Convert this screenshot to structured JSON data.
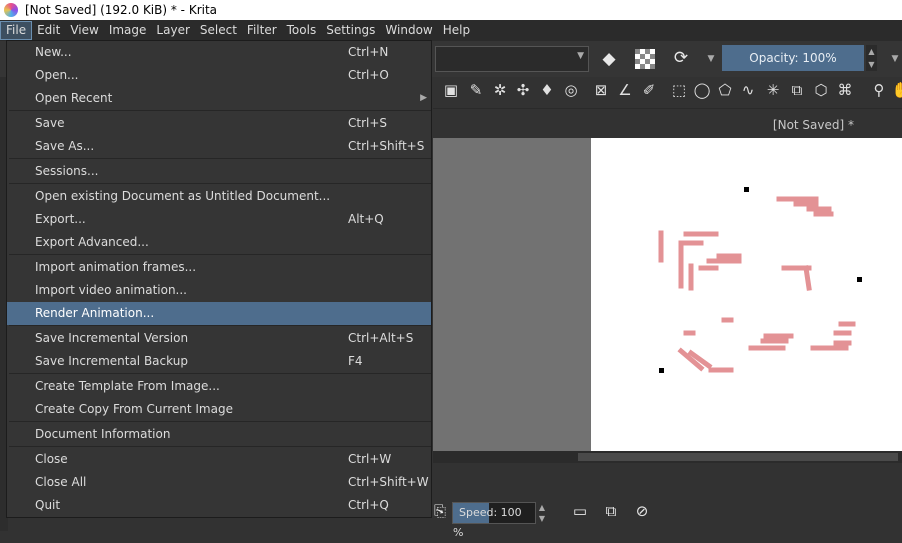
{
  "window": {
    "title": "[Not Saved]  (192.0 KiB)  * - Krita"
  },
  "menubar": {
    "items": [
      "File",
      "Edit",
      "View",
      "Image",
      "Layer",
      "Select",
      "Filter",
      "Tools",
      "Settings",
      "Window",
      "Help"
    ],
    "active": "File"
  },
  "toolbar": {
    "opacity_label": "Opacity: 100%"
  },
  "document": {
    "tab_label": "[Not Saved]  *"
  },
  "timeline": {
    "speed_label": "Speed: 100 %",
    "speed_fraction": 0.44
  },
  "file_menu": {
    "items": [
      {
        "label": "New...",
        "shortcut": "Ctrl+N"
      },
      {
        "label": "Open...",
        "shortcut": "Ctrl+O"
      },
      {
        "label": "Open Recent",
        "shortcut": "",
        "submenu": true
      },
      {
        "separator": true
      },
      {
        "label": "Save",
        "shortcut": "Ctrl+S"
      },
      {
        "label": "Save As...",
        "shortcut": "Ctrl+Shift+S"
      },
      {
        "separator": true
      },
      {
        "label": "Sessions...",
        "shortcut": ""
      },
      {
        "separator": true
      },
      {
        "label": "Open existing Document as Untitled Document...",
        "shortcut": ""
      },
      {
        "label": "Export...",
        "shortcut": "Alt+Q"
      },
      {
        "label": "Export Advanced...",
        "shortcut": ""
      },
      {
        "separator": true
      },
      {
        "label": "Import animation frames...",
        "shortcut": ""
      },
      {
        "label": "Import video animation...",
        "shortcut": ""
      },
      {
        "label": "Render Animation...",
        "shortcut": "",
        "highlighted": true
      },
      {
        "separator": true
      },
      {
        "label": "Save Incremental Version",
        "shortcut": "Ctrl+Alt+S"
      },
      {
        "label": "Save Incremental Backup",
        "shortcut": "F4"
      },
      {
        "separator": true
      },
      {
        "label": "Create Template From Image...",
        "shortcut": ""
      },
      {
        "label": "Create Copy From Current Image",
        "shortcut": ""
      },
      {
        "separator": true
      },
      {
        "label": "Document Information",
        "shortcut": ""
      },
      {
        "separator": true
      },
      {
        "label": "Close",
        "shortcut": "Ctrl+W"
      },
      {
        "label": "Close All",
        "shortcut": "Ctrl+Shift+W"
      },
      {
        "label": "Quit",
        "shortcut": "Ctrl+Q"
      }
    ]
  },
  "colors": {
    "accent": "#4e6d8d",
    "stroke": "#e39295"
  },
  "icons": [
    "eraser-icon",
    "transparency-icon",
    "reload-icon",
    "gradient-icon",
    "eyedropper-icon",
    "select-rect-icon",
    "select-ellipse-icon",
    "zoom-icon"
  ]
}
